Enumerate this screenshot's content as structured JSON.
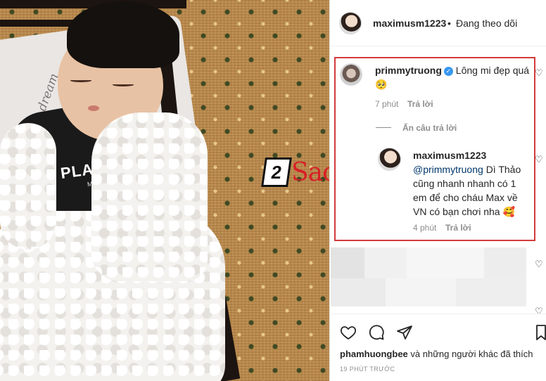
{
  "header": {
    "username": "maximusm1223",
    "separator": "•",
    "follow_state": "Đang theo dõi"
  },
  "comments": [
    {
      "username": "primmytruong",
      "verified": true,
      "text": "Lông mi đẹp quá 🥺",
      "time": "7 phút",
      "reply_label": "Trả lời",
      "toggle_label": "Ẩn câu trả lời",
      "replies": [
        {
          "username": "maximusm1223",
          "mention": "@primmytruong",
          "text": "Dì Thảo cũng nhanh nhanh có 1 em để cho cháu Max về VN có bạn chơi nha 🥰",
          "time": "4 phút",
          "reply_label": "Trả lời"
        }
      ]
    }
  ],
  "photo": {
    "shirt_text": "PLAY",
    "shirt_subtext": "MAX",
    "pillow_text": "I don't dream"
  },
  "watermark": {
    "number": "2",
    "text": "Sao"
  },
  "footer": {
    "likes_user": "phamhuongbee",
    "likes_rest": "và những người khác đã thích",
    "timestamp": "19 PHÚT TRƯỚC"
  },
  "icons": {
    "like": "heart-icon",
    "comment": "comment-icon",
    "share": "share-icon",
    "save": "bookmark-icon",
    "verified": "verified-badge-icon"
  },
  "colors": {
    "highlight_border": "#d43a3a",
    "verified": "#3897f0",
    "watermark_red": "#d81f26"
  }
}
